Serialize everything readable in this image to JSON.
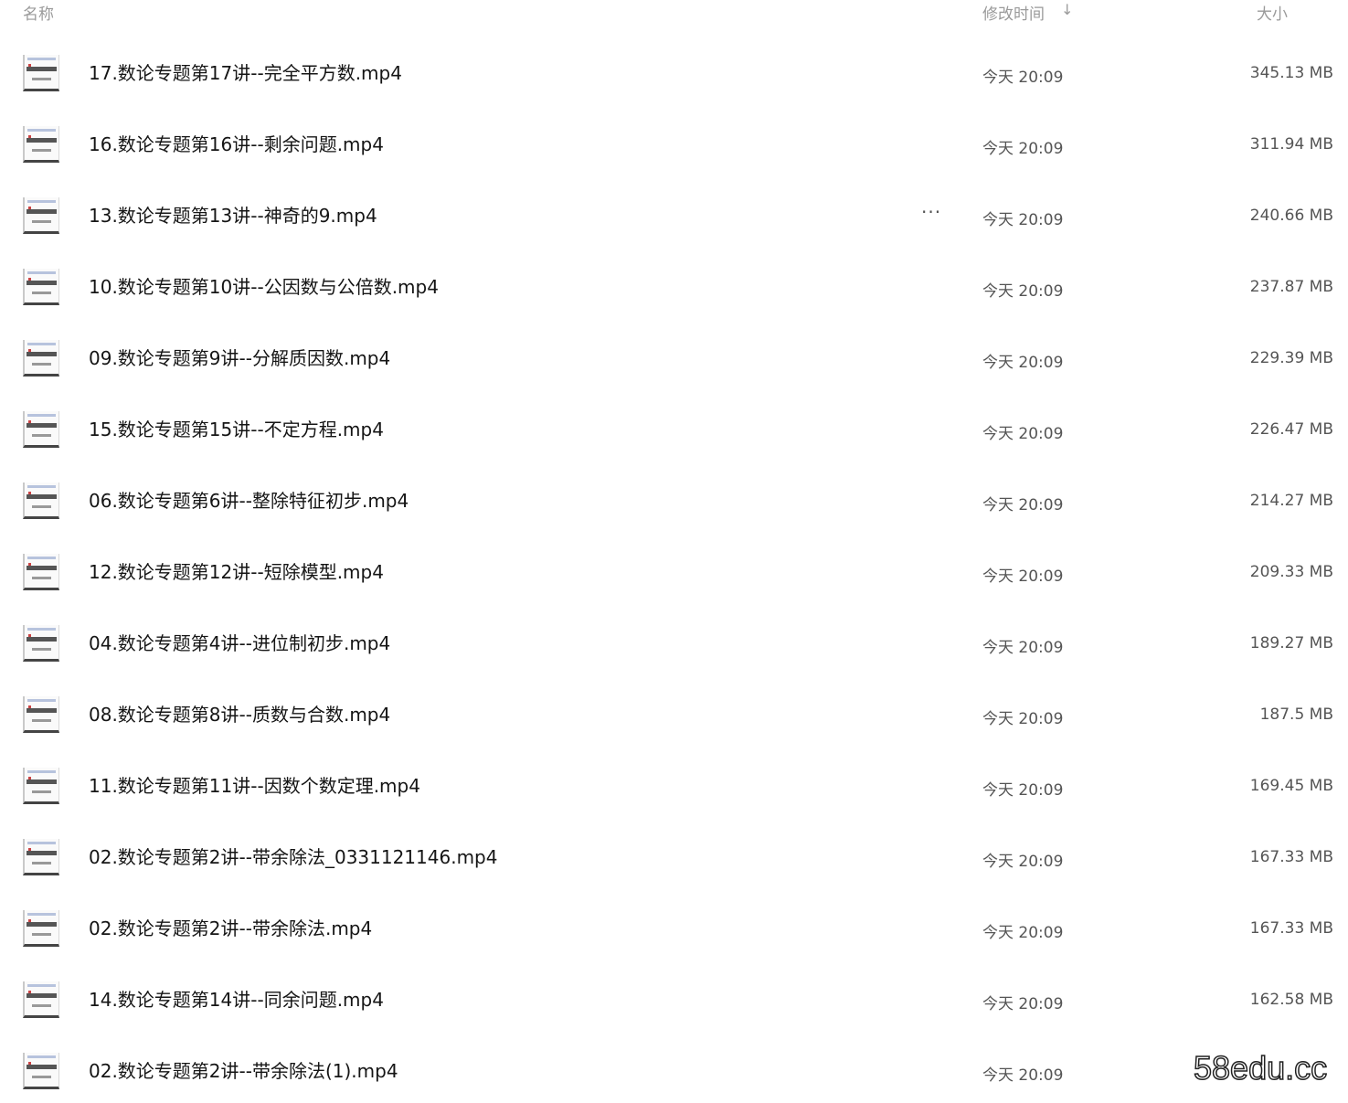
{
  "header": {
    "name_label": "名称",
    "time_label": "修改时间",
    "sort_arrow": "↓",
    "size_label": "大小"
  },
  "files": [
    {
      "name": "17.数论专题第17讲--完全平方数.mp4",
      "time": "今天 20:09",
      "size": "345.13 MB"
    },
    {
      "name": "16.数论专题第16讲--剩余问题.mp4",
      "time": "今天 20:09",
      "size": "311.94 MB"
    },
    {
      "name": "13.数论专题第13讲--神奇的9.mp4",
      "time": "今天 20:09",
      "size": "240.66 MB",
      "more": "···"
    },
    {
      "name": "10.数论专题第10讲--公因数与公倍数.mp4",
      "time": "今天 20:09",
      "size": "237.87 MB"
    },
    {
      "name": "09.数论专题第9讲--分解质因数.mp4",
      "time": "今天 20:09",
      "size": "229.39 MB"
    },
    {
      "name": "15.数论专题第15讲--不定方程.mp4",
      "time": "今天 20:09",
      "size": "226.47 MB"
    },
    {
      "name": "06.数论专题第6讲--整除特征初步.mp4",
      "time": "今天 20:09",
      "size": "214.27 MB"
    },
    {
      "name": "12.数论专题第12讲--短除模型.mp4",
      "time": "今天 20:09",
      "size": "209.33 MB"
    },
    {
      "name": "04.数论专题第4讲--进位制初步.mp4",
      "time": "今天 20:09",
      "size": "189.27 MB"
    },
    {
      "name": "08.数论专题第8讲--质数与合数.mp4",
      "time": "今天 20:09",
      "size": "187.5 MB"
    },
    {
      "name": "11.数论专题第11讲--因数个数定理.mp4",
      "time": "今天 20:09",
      "size": "169.45 MB"
    },
    {
      "name": "02.数论专题第2讲--带余除法_0331121146.mp4",
      "time": "今天 20:09",
      "size": "167.33 MB"
    },
    {
      "name": "02.数论专题第2讲--带余除法.mp4",
      "time": "今天 20:09",
      "size": "167.33 MB"
    },
    {
      "name": "14.数论专题第14讲--同余问题.mp4",
      "time": "今天 20:09",
      "size": "162.58 MB"
    },
    {
      "name": "02.数论专题第2讲--带余除法(1).mp4",
      "time": "今天 20:09",
      "size": ""
    }
  ],
  "watermark": "58edu.cc"
}
